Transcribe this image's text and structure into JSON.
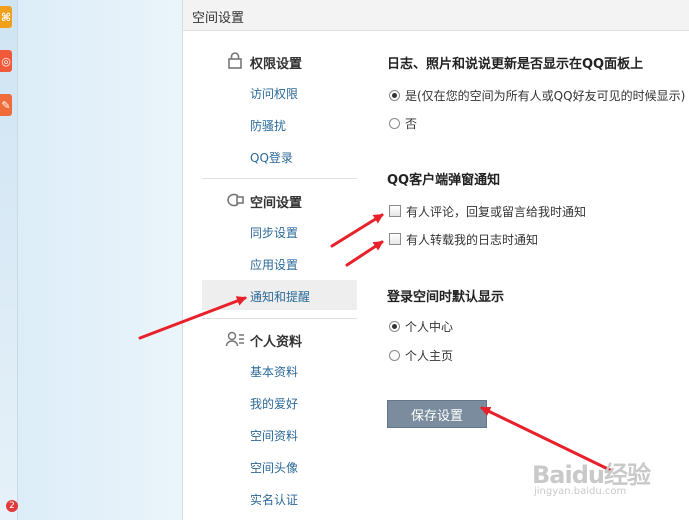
{
  "panel": {
    "title": "空间设置"
  },
  "sidebar": {
    "sections": [
      {
        "title": "权限设置",
        "items": [
          "访问权限",
          "防骚扰",
          "QQ登录"
        ]
      },
      {
        "title": "空间设置",
        "items": [
          "同步设置",
          "应用设置",
          "通知和提醒"
        ]
      },
      {
        "title": "个人资料",
        "items": [
          "基本资料",
          "我的爱好",
          "空间资料",
          "空间头像",
          "实名认证"
        ]
      }
    ],
    "active_item": "通知和提醒"
  },
  "content": {
    "section1": {
      "title": "日志、照片和说说更新是否显示在QQ面板上",
      "options": [
        {
          "label": "是(仅在您的空间为所有人或QQ好友可见的时候显示)",
          "checked": true
        },
        {
          "label": "否",
          "checked": false
        }
      ]
    },
    "section2": {
      "title": "QQ客户端弹窗通知",
      "options": [
        {
          "label": "有人评论，回复或留言给我时通知",
          "checked": false
        },
        {
          "label": "有人转载我的日志时通知",
          "checked": false
        }
      ]
    },
    "section3": {
      "title": "登录空间时默认显示",
      "options": [
        {
          "label": "个人中心",
          "checked": true
        },
        {
          "label": "个人主页",
          "checked": false
        }
      ]
    },
    "save_label": "保存设置"
  },
  "left_strip": {
    "badge": "2"
  },
  "watermark": {
    "main": "Baidu经验",
    "sub": "jingyan.baidu.com"
  },
  "colors": {
    "link": "#2b6a98",
    "annotation": "#e8202a",
    "button": "#7a8c9e"
  }
}
